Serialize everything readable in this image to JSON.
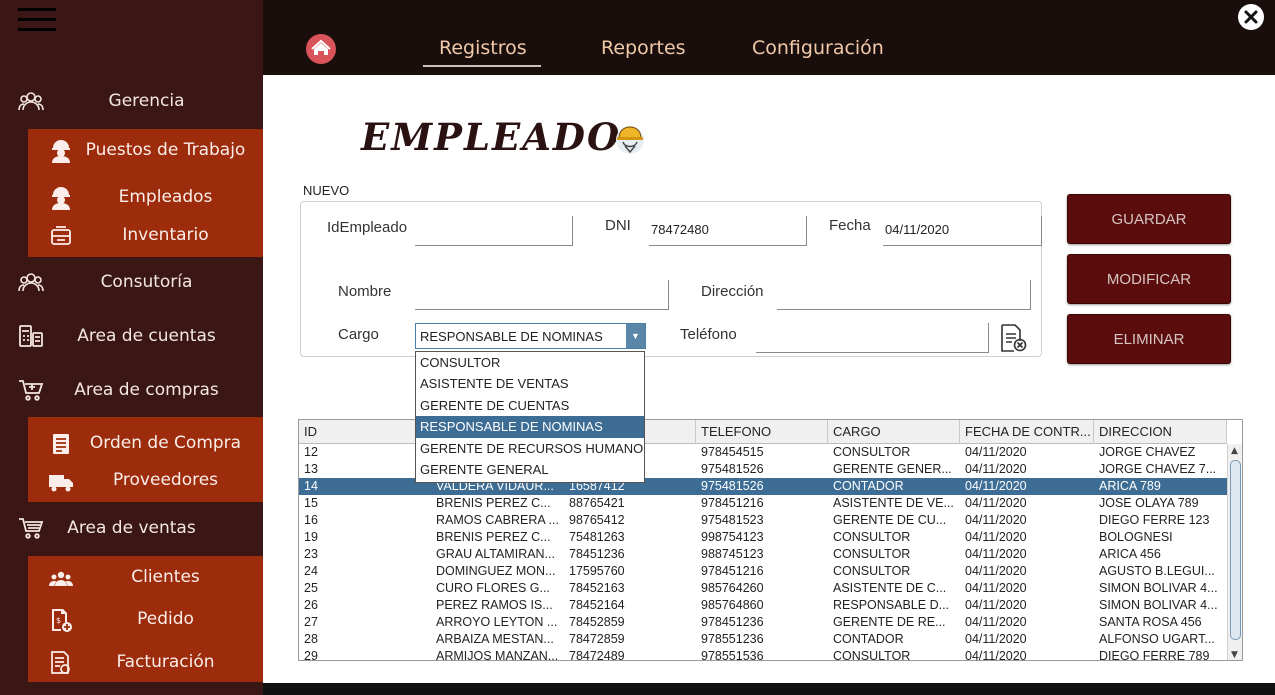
{
  "sidebar": {
    "items": [
      {
        "label": "Gerencia",
        "icon": "team-icon"
      },
      {
        "label": "Consutoría",
        "icon": "team-icon"
      },
      {
        "label": "Area de cuentas",
        "icon": "calculator-icon"
      },
      {
        "label": "Area de compras",
        "icon": "cart-plus-icon"
      },
      {
        "label": "Area de ventas",
        "icon": "cart-icon"
      }
    ],
    "gerencia_sub": [
      "Puestos de Trabajo",
      "Empleados",
      "Inventario"
    ],
    "compras_sub": [
      "Orden de Compra",
      "Proveedores"
    ],
    "ventas_sub": [
      "Clientes",
      "Pedido",
      "Facturación"
    ]
  },
  "nav": {
    "tabs": [
      "Registros",
      "Reportes",
      "Configuración"
    ],
    "active": "Registros"
  },
  "form": {
    "title": "EMPLEADO",
    "section": "NUEVO",
    "id_label": "IdEmpleado",
    "id_value": "",
    "dni_label": "DNI",
    "dni_value": "78472480",
    "fecha_label": "Fecha",
    "fecha_value": "04/11/2020",
    "nombre_label": "Nombre",
    "nombre_value": "",
    "direccion_label": "Dirección",
    "direccion_value": "",
    "cargo_label": "Cargo",
    "cargo_value": "RESPONSABLE DE NOMINAS",
    "telefono_label": "Teléfono",
    "telefono_value": "",
    "cargo_options": [
      "CONSULTOR",
      "ASISTENTE DE VENTAS",
      "GERENTE DE CUENTAS",
      "RESPONSABLE DE NOMINAS",
      "GERENTE DE RECURSOS HUMANOS",
      "GERENTE GENERAL"
    ]
  },
  "buttons": {
    "guardar": "GUARDAR",
    "modificar": "MODIFICAR",
    "eliminar": "ELIMINAR"
  },
  "table": {
    "columns": [
      "ID",
      "",
      "",
      "TELEFONO",
      "CARGO",
      "FECHA DE CONTR...",
      "DIRECCION"
    ],
    "rows": [
      [
        "12",
        "",
        "",
        "978454515",
        "CONSULTOR",
        "04/11/2020",
        "JORGE CHAVEZ"
      ],
      [
        "13",
        "",
        "",
        "975481526",
        "GERENTE GENER...",
        "04/11/2020",
        "JORGE CHAVEZ 7..."
      ],
      [
        "14",
        "VALDERA VIDAUR...",
        "16587412",
        "975481526",
        "CONTADOR",
        "04/11/2020",
        "ARICA 789"
      ],
      [
        "15",
        "BRENIS PEREZ C...",
        "88765421",
        "978451216",
        "ASISTENTE DE VE...",
        "04/11/2020",
        "JOSE OLAYA 789"
      ],
      [
        "16",
        "RAMOS CABRERA ...",
        "98765412",
        "975481523",
        "GERENTE DE CU...",
        "04/11/2020",
        "DIEGO FERRE 123"
      ],
      [
        "19",
        "BRENIS PEREZ C...",
        "75481263",
        "998754123",
        "CONSULTOR",
        "04/11/2020",
        "BOLOGNESI"
      ],
      [
        "23",
        "GRAU ALTAMIRAN...",
        "78451236",
        "988745123",
        "CONSULTOR",
        "04/11/2020",
        "ARICA 456"
      ],
      [
        "24",
        "DOMINGUEZ MON...",
        "17595760",
        "978451216",
        "CONSULTOR",
        "04/11/2020",
        "AGUSTO B.LEGUI..."
      ],
      [
        "25",
        "CURO FLORES G...",
        "78452163",
        "985764260",
        "ASISTENTE DE C...",
        "04/11/2020",
        "SIMON BOLIVAR 4..."
      ],
      [
        "26",
        "PEREZ RAMOS IS...",
        "78452164",
        "985764860",
        "RESPONSABLE D...",
        "04/11/2020",
        "SIMON BOLIVAR 4..."
      ],
      [
        "27",
        "ARROYO LEYTON ...",
        "78452859",
        "978451236",
        "GERENTE DE RE...",
        "04/11/2020",
        "SANTA ROSA 456"
      ],
      [
        "28",
        "ARBAIZA MESTAN...",
        "78472859",
        "978551236",
        "CONTADOR",
        "04/11/2020",
        "ALFONSO UGART..."
      ],
      [
        "29",
        "ARMIJOS MANZAN...",
        "78472489",
        "978551536",
        "CONSULTOR",
        "04/11/2020",
        "DIEGO FERRE 789"
      ]
    ],
    "selected_row": 2
  },
  "colors": {
    "sidebar_bg": "#3a1715",
    "sub_menu_bg": "#9c2c0b",
    "topbar_bg": "#1a0e0d",
    "button_bg": "#5a0d0c",
    "selection": "#3d6d95",
    "nav_text": "#f0c9a8"
  }
}
